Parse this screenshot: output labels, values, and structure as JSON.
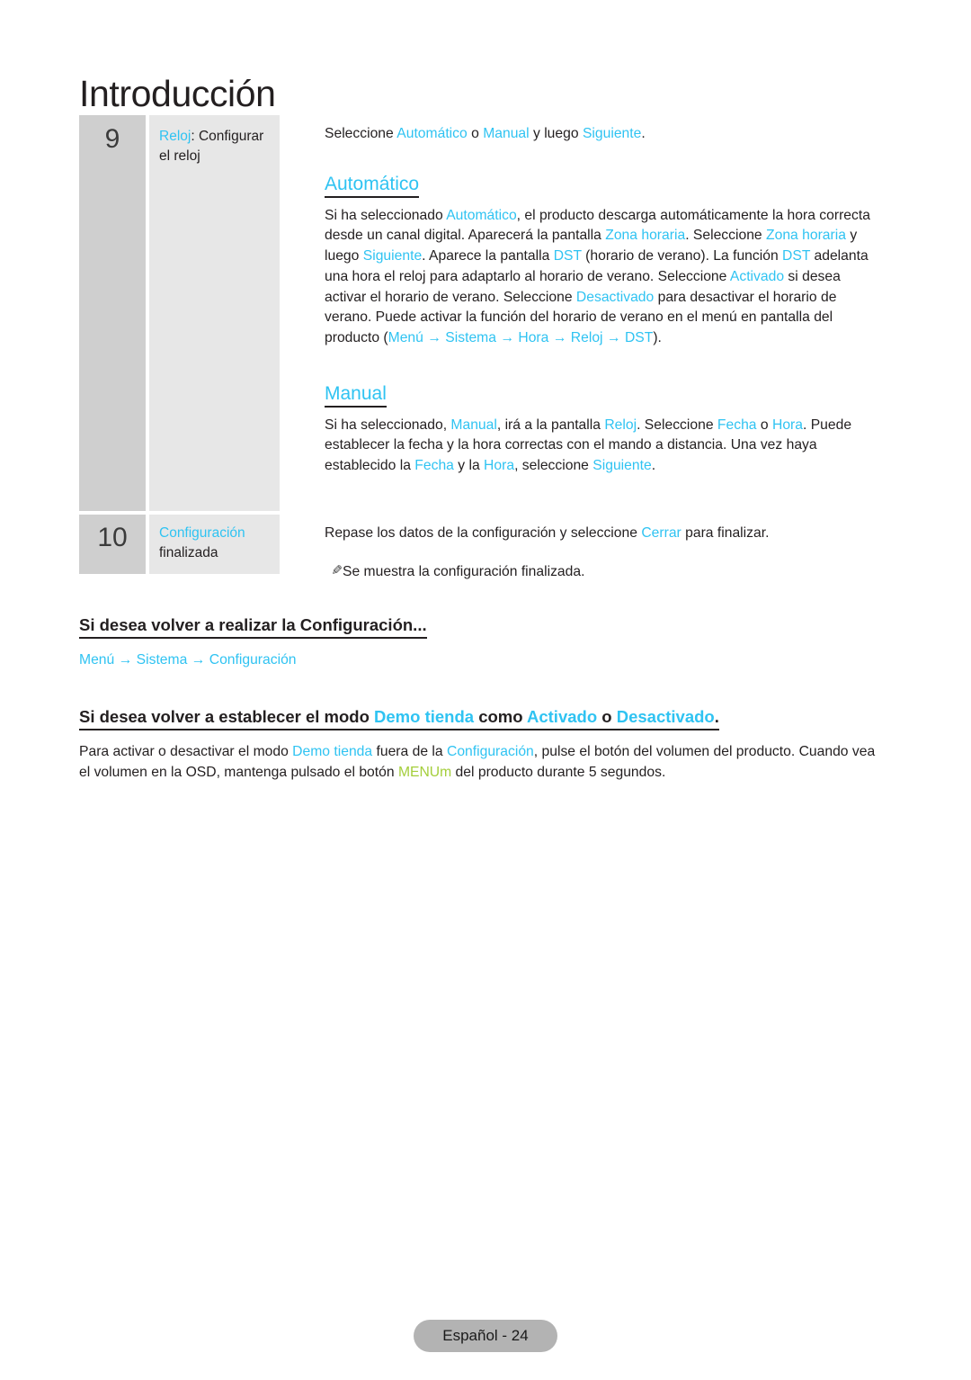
{
  "header": {
    "title": "Introducción"
  },
  "steps": [
    {
      "number": "9",
      "label_link": "Reloj",
      "label_rest": ": Configurar el reloj",
      "intro": {
        "p1": "Seleccione ",
        "l1": "Automático",
        "p2": " o ",
        "l2": "Manual",
        "p3": " y luego ",
        "l3": "Siguiente",
        "p4": "."
      },
      "auto": {
        "heading": "Automático",
        "t1": "Si ha seleccionado ",
        "l1": "Automático",
        "t2": ", el producto descarga automáticamente la hora correcta desde un canal digital. Aparecerá la pantalla ",
        "l2": "Zona horaria",
        "t3": ". Seleccione ",
        "l3": "Zona horaria",
        "t4": " y luego ",
        "l4": "Siguiente",
        "t5": ". Aparece la pantalla ",
        "l5": "DST",
        "t6": " (horario de verano). La función ",
        "l6": "DST",
        "t7": " adelanta una hora el reloj para adaptarlo al horario de verano. Seleccione ",
        "l7": "Activado",
        "t8": " si desea activar el horario de verano. Seleccione ",
        "l8": "Desactivado",
        "t9": " para desactivar el horario de verano. Puede activar la función del horario de verano en el menú en pantalla del producto (",
        "l9": "Menú",
        "arrow1": " → ",
        "l10": "Sistema",
        "arrow2": " → ",
        "l11": "Hora",
        "arrow3": " → ",
        "l12": "Reloj",
        "arrow4": " → ",
        "l13": "DST",
        "t10": ")."
      },
      "manual": {
        "heading": "Manual",
        "t1": "Si ha seleccionado, ",
        "l1": "Manual",
        "t2": ", irá a la pantalla ",
        "l2": "Reloj",
        "t3": ". Seleccione ",
        "l3": "Fecha",
        "t4": " o ",
        "l4": "Hora",
        "t5": ". Puede establecer la fecha y la hora correctas con el mando a distancia. Una vez haya establecido la ",
        "l5": "Fecha",
        "t6": " y la ",
        "l6": "Hora",
        "t7": ", seleccione ",
        "l7": "Siguiente",
        "t8": "."
      }
    },
    {
      "number": "10",
      "label_link": "Configuración",
      "label_rest": "finalizada",
      "body": {
        "t1": "Repase los datos de la configuración y seleccione ",
        "l1": "Cerrar",
        "t2": " para finalizar.",
        "note_icon": "pencil-icon",
        "note": "Se muestra la configuración finalizada."
      }
    }
  ],
  "section_reconfig": {
    "heading": "Si desea volver a realizar la Configuración...",
    "path": {
      "p1": "Menú",
      "a1": " → ",
      "p2": "Sistema",
      "a2": " → ",
      "p3": "Configuración"
    }
  },
  "section_demo": {
    "heading": {
      "h1": "Si desea volver a establecer el modo ",
      "hl1": "Demo tienda",
      "h2": " como ",
      "hl2": "Activado",
      "h3": " o ",
      "hl3": "Desactivado",
      "h4": "."
    },
    "body": {
      "t1": "Para activar o desactivar el modo ",
      "l1": "Demo tienda",
      "t2": " fuera de la ",
      "l2": "Configuración",
      "t3": ", pulse el botón del volumen del producto. Cuando vea el volumen en la OSD, mantenga pulsado el botón ",
      "g1": "MENUm",
      "t4": " del producto durante 5 segundos."
    }
  },
  "footer": {
    "label": "Español - 24"
  },
  "colors": {
    "accent_cyan": "#2fc3f2",
    "accent_green": "#a4ce3b",
    "cell_number_bg": "#cfcfcf",
    "cell_label_bg": "#e7e7e7",
    "footer_pill_bg": "#b3b3b3",
    "text": "#231f20"
  }
}
